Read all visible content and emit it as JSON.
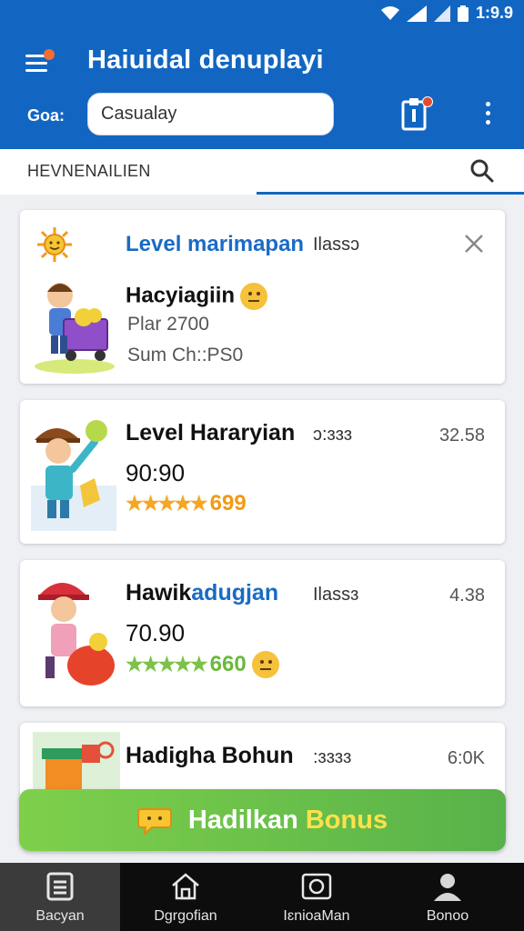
{
  "status_bar": {
    "time": "1:9.9"
  },
  "app_bar": {
    "title": "Haiuidal denuplayi",
    "goal_label": "Goa:",
    "search_value": "Casualay"
  },
  "tabs": {
    "label": "HEVNENAILIEN"
  },
  "cards": [
    {
      "title": "Level marimapan",
      "meta": "Ilassɔ",
      "name": "Hacyiagiin",
      "line1": "Plar 2700",
      "line2": "Sum Ch::PS0"
    },
    {
      "title": "Level Hararyian",
      "meta": "ɔ:ɜɜɜ",
      "score": "32.58",
      "value": "90:90",
      "stars": "★★★★★",
      "rating": "699"
    },
    {
      "title_a": "Hawik",
      "title_b": "adugjan",
      "meta": "Ilassɜ",
      "score": "4.38",
      "value": "70.90",
      "stars": "★★★★★",
      "rating": "660"
    },
    {
      "title": "Hadigha Bohun",
      "meta": ":ɜɜɜɜ",
      "score": "6:0K"
    }
  ],
  "bonus_button": {
    "label_a": "Hadilkan",
    "label_b": "Bonus"
  },
  "bottom_nav": [
    {
      "label": "Bacyan",
      "icon": "list-icon"
    },
    {
      "label": "Dgrgofian",
      "icon": "home-icon"
    },
    {
      "label": "IɛnioaMan",
      "icon": "camera-icon"
    },
    {
      "label": "Bonoo",
      "icon": "profile-icon"
    }
  ],
  "colors": {
    "primary": "#1266c2",
    "accent_green": "#58b249",
    "bonus_yellow": "#ffe14a"
  }
}
